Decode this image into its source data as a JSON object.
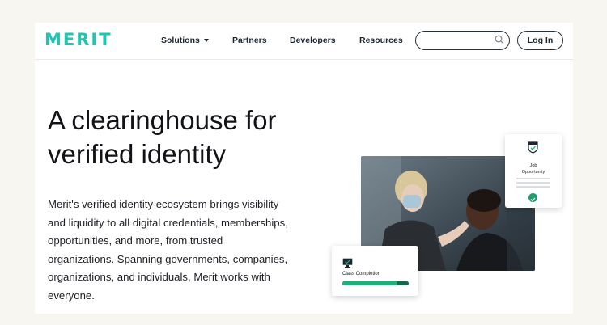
{
  "header": {
    "logo_text": "MERIT",
    "nav": {
      "solutions": "Solutions",
      "partners": "Partners",
      "developers": "Developers",
      "resources": "Resources"
    },
    "search": {
      "value": "",
      "placeholder": ""
    },
    "login_label": "Log In"
  },
  "hero": {
    "title_line1": "A clearinghouse for",
    "title_line2": "verified identity",
    "body": "Merit's verified identity ecosystem brings visibility and liquidity to all digital credentials, memberships, opportunities, and more, from trusted organizations. Spanning governments, companies, organizations, and individuals, Merit works with everyone."
  },
  "cards": {
    "job": {
      "title_line1": "Job",
      "title_line2": "Opportunity",
      "icon": "shield-check-icon"
    },
    "class_completion": {
      "title": "Class Completion",
      "icon": "monitor-icon",
      "progress": 0.82
    }
  },
  "colors": {
    "brand": "#1ec5b2",
    "nav_text": "#1b2630",
    "progress_fill": "#1fb07a",
    "progress_track": "#14684a",
    "check": "#1f9e6c",
    "page_bg": "#f7f6f1"
  }
}
